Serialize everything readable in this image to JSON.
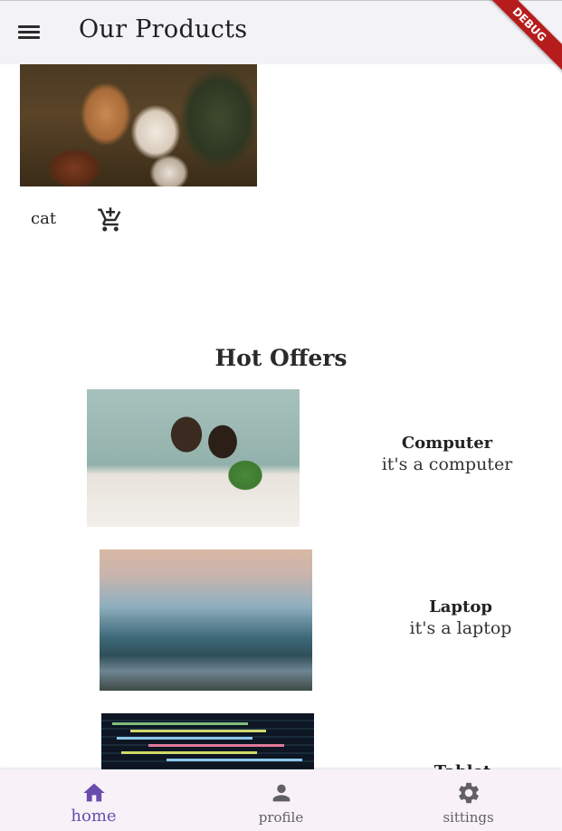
{
  "appbar": {
    "title": "Our Products",
    "debug_label": "DEBUG",
    "menu_icon": "menu-icon"
  },
  "product": {
    "name": "cat",
    "action_icon": "add-shopping-cart-icon"
  },
  "hot_offers": {
    "title": "Hot Offers",
    "items": [
      {
        "title": "Computer",
        "description": "it's a computer"
      },
      {
        "title": "Laptop",
        "description": "it's a laptop"
      },
      {
        "title": "Tablet",
        "description": ""
      }
    ]
  },
  "bottom_nav": {
    "items": [
      {
        "label": "home",
        "icon": "home-icon",
        "active": true
      },
      {
        "label": "profile",
        "icon": "person-icon",
        "active": false
      },
      {
        "label": "sittings",
        "icon": "gear-icon",
        "active": false
      }
    ]
  },
  "colors": {
    "accent": "#6a4caf",
    "appbar_bg": "#f3f2f6",
    "debug_banner": "#b71c1c",
    "nav_bg": "#f8f2f8"
  }
}
